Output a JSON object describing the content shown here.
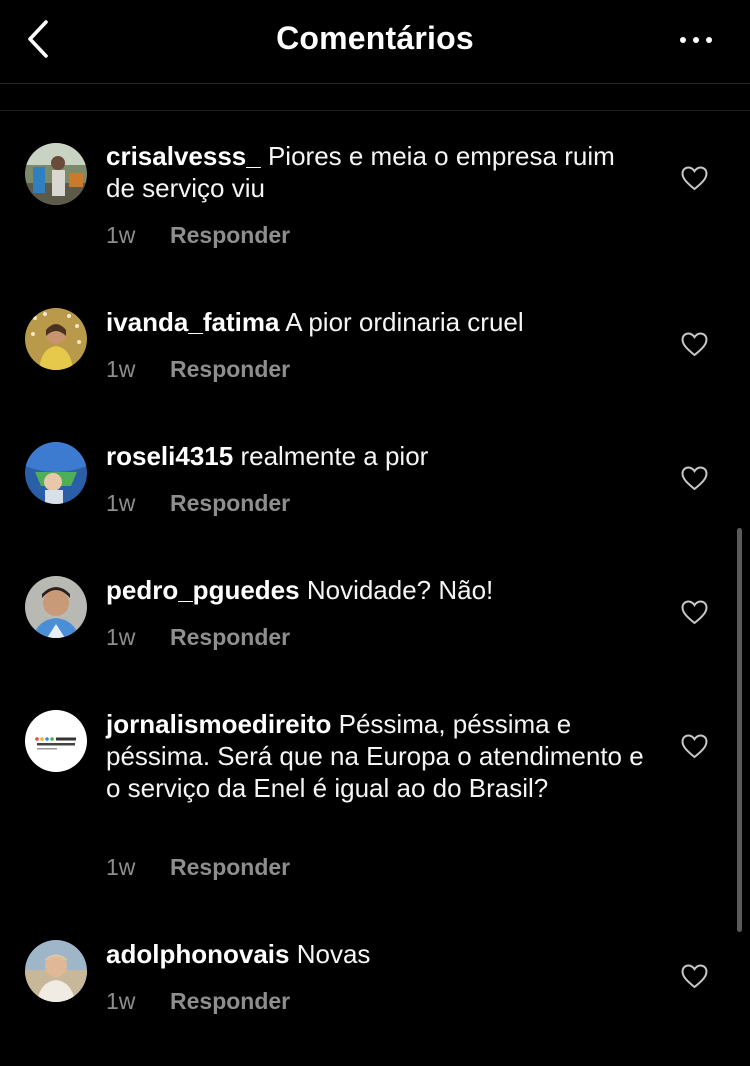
{
  "header": {
    "title": "Comentários"
  },
  "icons": {
    "back": "chevron-left-icon",
    "more": "more-horizontal-icon",
    "like": "heart-outline-icon"
  },
  "colors": {
    "background": "#000000",
    "text": "#f5f5f5",
    "secondary_text": "#8e8e8e"
  },
  "comments": [
    {
      "username": "crisalvesss_",
      "text": "Piores e meia o empresa ruim de serviço viu",
      "time": "1w",
      "reply_label": "Responder"
    },
    {
      "username": "ivanda_fatima",
      "text": "A pior ordinaria cruel",
      "time": "1w",
      "reply_label": "Responder"
    },
    {
      "username": "roseli4315",
      "text": "realmente a pior",
      "time": "1w",
      "reply_label": "Responder"
    },
    {
      "username": "pedro_pguedes",
      "text": "Novidade? Não!",
      "time": "1w",
      "reply_label": "Responder"
    },
    {
      "username": "jornalismoedireito",
      "text": "Péssima, péssima e péssima. Será que na Europa o atendimento e o serviço da Enel é igual ao do Brasil?",
      "time": "1w",
      "reply_label": "Responder",
      "avatar_logo_text": "JORNALISMO & DIREITO"
    },
    {
      "username": "adolphonovais",
      "text": "Novas",
      "time": "1w",
      "reply_label": "Responder"
    }
  ]
}
